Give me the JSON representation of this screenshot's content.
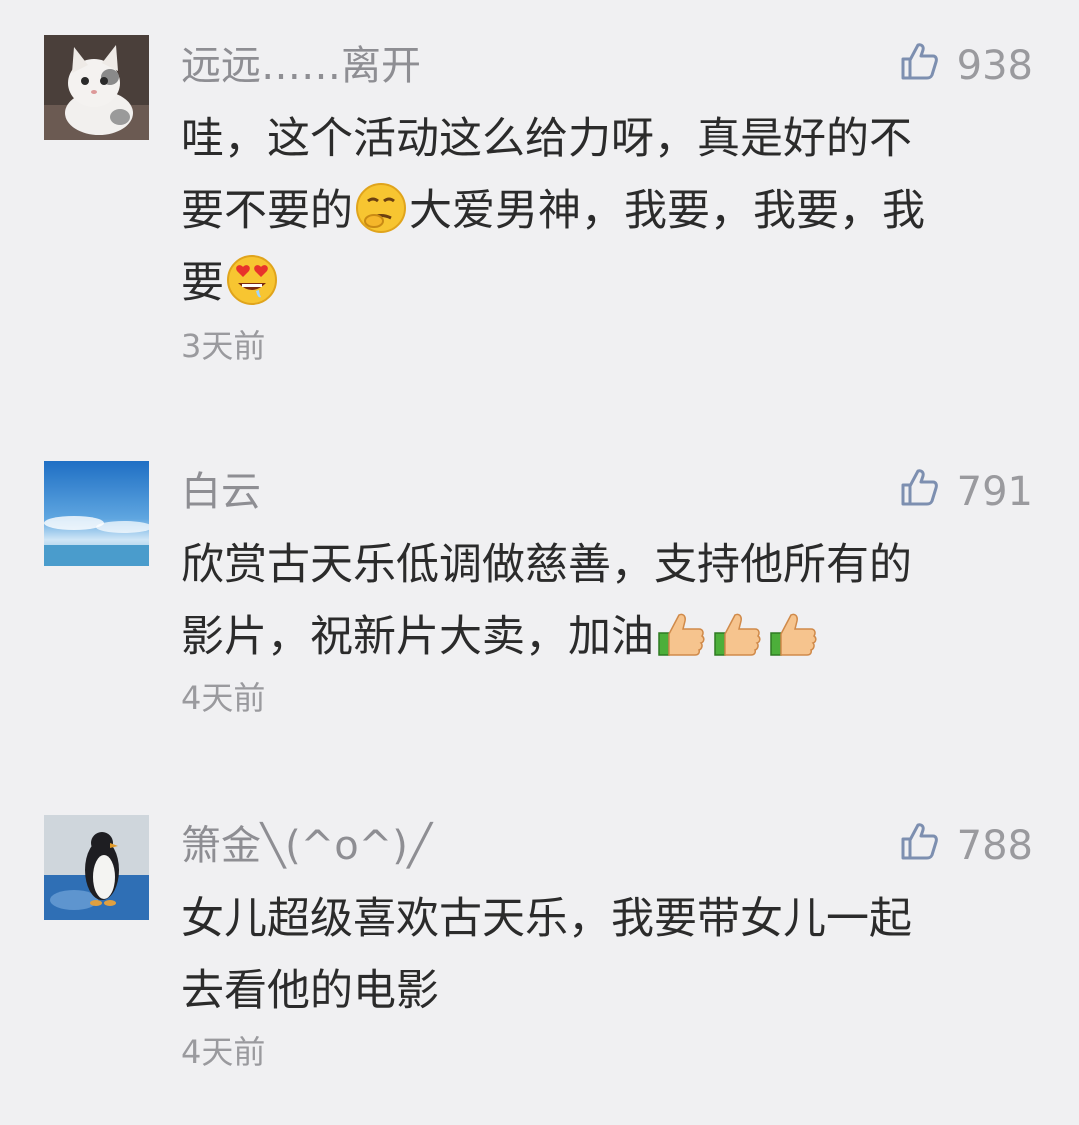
{
  "comments": [
    {
      "user": "远远……离开",
      "likes": "938",
      "lines": [
        [
          "哇，这个活动这么给力呀，真是好的不"
        ],
        [
          "要不要的",
          "[emoji:smirk-face]",
          "大爱男神，我要，我要，我"
        ],
        [
          "要",
          "[emoji:heart-eyes-drool]"
        ]
      ],
      "time": "3天前"
    },
    {
      "user": "白云",
      "likes": "791",
      "lines": [
        [
          "欣赏古天乐低调做慈善，支持他所有的"
        ],
        [
          "影片，祝新片大卖，加油",
          "[emoji:thumbs-up]",
          "[emoji:thumbs-up]",
          "[emoji:thumbs-up]"
        ]
      ],
      "time": "4天前"
    },
    {
      "user": "箫金╲(^o^)╱",
      "likes": "788",
      "lines": [
        [
          "女儿超级喜欢古天乐，我要带女儿一起"
        ],
        [
          "去看他的电影"
        ]
      ],
      "time": "4天前"
    }
  ],
  "colors": {
    "background": "#f0f0f2",
    "username": "#8e8e93",
    "body_text": "#2b2b2b",
    "meta": "#9a9a9e",
    "like_icon": "#7d8fb0"
  },
  "icons": {
    "like": "thumbs-up-outline-icon"
  }
}
